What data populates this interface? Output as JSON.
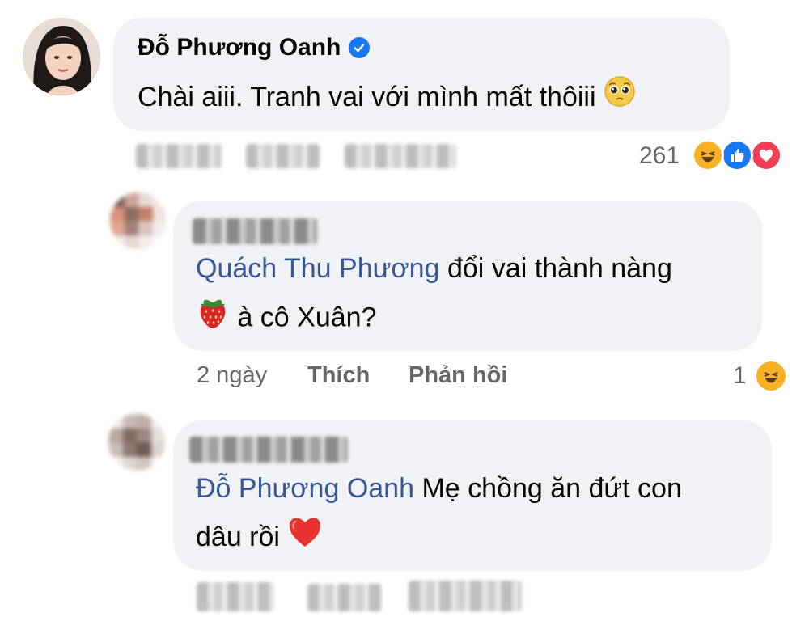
{
  "comments": [
    {
      "author": "Đỗ Phương Oanh",
      "verified": true,
      "text": "Chài aiii. Tranh vai với mình mất thôiii",
      "emoji": "pleading-face",
      "reaction_count": "261",
      "reactions": [
        "haha",
        "like",
        "love"
      ]
    }
  ],
  "replies": [
    {
      "mention": "Quách Thu Phương",
      "text_line1": " đổi vai thành nàng",
      "text_line2": " à cô Xuân?",
      "emoji": "strawberry",
      "time": "2 ngày",
      "like_label": "Thích",
      "reply_label": "Phản hồi",
      "reaction_count": "1",
      "reactions": [
        "haha"
      ]
    },
    {
      "mention": "Đỗ Phương Oanh",
      "text_line1": " Mẹ chồng ăn đứt con",
      "text_line2": "dâu rồi",
      "emoji": "red-heart"
    }
  ],
  "colors": {
    "bubble": "#f0f2f5",
    "mention": "#385898",
    "meta": "#65676b",
    "verified": "#1877f2",
    "like": "#1877f2",
    "love": "#f33e58",
    "haha": "#f7b125"
  }
}
